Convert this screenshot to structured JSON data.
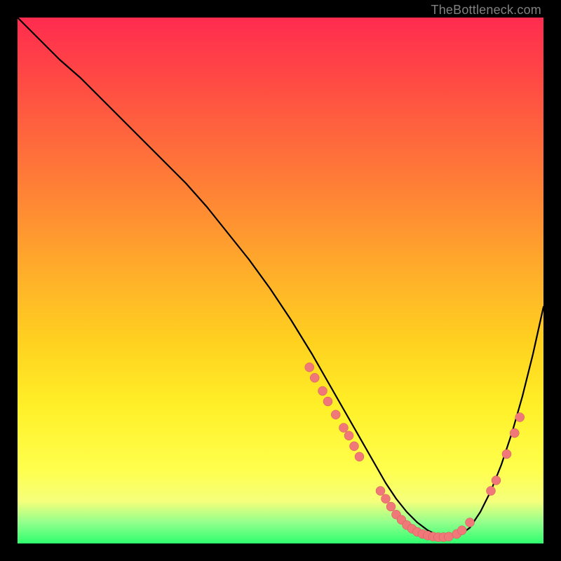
{
  "watermark": "TheBottleneck.com",
  "chart_data": {
    "type": "line",
    "title": "",
    "xlabel": "",
    "ylabel": "",
    "xlim": [
      0,
      100
    ],
    "ylim": [
      0,
      100
    ],
    "grid": false,
    "series": [
      {
        "name": "curve",
        "x": [
          0,
          4,
          8,
          12,
          16,
          20,
          24,
          28,
          32,
          36,
          40,
          44,
          48,
          52,
          56,
          58,
          60,
          62,
          64,
          66,
          68,
          70,
          72,
          74,
          76,
          78,
          80,
          82,
          84,
          86,
          88,
          90,
          92,
          94,
          96,
          98,
          100
        ],
        "y": [
          100,
          96,
          92,
          88.5,
          84.5,
          80.5,
          76.5,
          72.5,
          68.5,
          64,
          59,
          54,
          48.5,
          42.5,
          36,
          32.5,
          29,
          25.5,
          22,
          18.5,
          15,
          11.5,
          8.5,
          6,
          4,
          2.5,
          1.5,
          1.2,
          1.5,
          3,
          6,
          10,
          15,
          21,
          28,
          36,
          45
        ]
      }
    ],
    "markers": [
      {
        "x": 55.5,
        "y": 33.5
      },
      {
        "x": 56.5,
        "y": 31.5
      },
      {
        "x": 58,
        "y": 29
      },
      {
        "x": 59,
        "y": 27
      },
      {
        "x": 60.5,
        "y": 24.5
      },
      {
        "x": 62,
        "y": 22
      },
      {
        "x": 63,
        "y": 20.5
      },
      {
        "x": 64,
        "y": 18.5
      },
      {
        "x": 65,
        "y": 16.5
      },
      {
        "x": 69,
        "y": 10
      },
      {
        "x": 70,
        "y": 8.5
      },
      {
        "x": 71,
        "y": 7
      },
      {
        "x": 72,
        "y": 5.5
      },
      {
        "x": 73,
        "y": 4.5
      },
      {
        "x": 74,
        "y": 3.5
      },
      {
        "x": 75,
        "y": 2.8
      },
      {
        "x": 76,
        "y": 2.2
      },
      {
        "x": 77,
        "y": 1.8
      },
      {
        "x": 78,
        "y": 1.5
      },
      {
        "x": 79,
        "y": 1.3
      },
      {
        "x": 80,
        "y": 1.2
      },
      {
        "x": 81,
        "y": 1.2
      },
      {
        "x": 82,
        "y": 1.3
      },
      {
        "x": 83.5,
        "y": 1.8
      },
      {
        "x": 84.5,
        "y": 2.5
      },
      {
        "x": 86,
        "y": 4
      },
      {
        "x": 90,
        "y": 10
      },
      {
        "x": 91,
        "y": 12
      },
      {
        "x": 93,
        "y": 17
      },
      {
        "x": 94.5,
        "y": 21
      },
      {
        "x": 95.5,
        "y": 24
      }
    ]
  }
}
